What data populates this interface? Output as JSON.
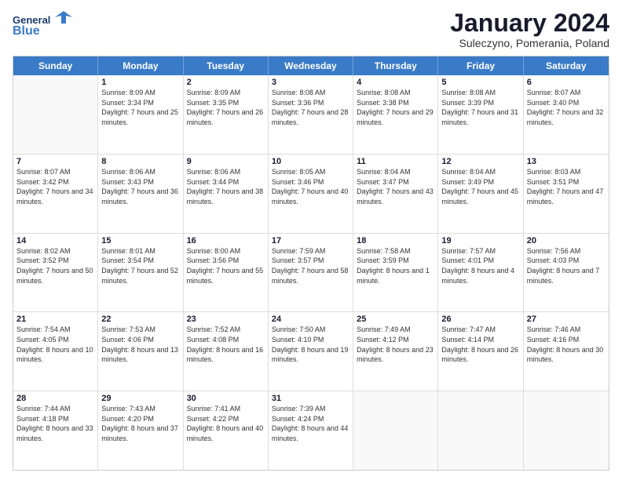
{
  "logo": {
    "line1": "General",
    "line2": "Blue"
  },
  "title": "January 2024",
  "subtitle": "Suleczyno, Pomerania, Poland",
  "header": {
    "days": [
      "Sunday",
      "Monday",
      "Tuesday",
      "Wednesday",
      "Thursday",
      "Friday",
      "Saturday"
    ]
  },
  "weeks": [
    [
      {
        "day": "",
        "sunrise": "",
        "sunset": "",
        "daylight": "",
        "empty": true
      },
      {
        "day": "1",
        "sunrise": "Sunrise: 8:09 AM",
        "sunset": "Sunset: 3:34 PM",
        "daylight": "Daylight: 7 hours and 25 minutes."
      },
      {
        "day": "2",
        "sunrise": "Sunrise: 8:09 AM",
        "sunset": "Sunset: 3:35 PM",
        "daylight": "Daylight: 7 hours and 26 minutes."
      },
      {
        "day": "3",
        "sunrise": "Sunrise: 8:08 AM",
        "sunset": "Sunset: 3:36 PM",
        "daylight": "Daylight: 7 hours and 28 minutes."
      },
      {
        "day": "4",
        "sunrise": "Sunrise: 8:08 AM",
        "sunset": "Sunset: 3:38 PM",
        "daylight": "Daylight: 7 hours and 29 minutes."
      },
      {
        "day": "5",
        "sunrise": "Sunrise: 8:08 AM",
        "sunset": "Sunset: 3:39 PM",
        "daylight": "Daylight: 7 hours and 31 minutes."
      },
      {
        "day": "6",
        "sunrise": "Sunrise: 8:07 AM",
        "sunset": "Sunset: 3:40 PM",
        "daylight": "Daylight: 7 hours and 32 minutes."
      }
    ],
    [
      {
        "day": "7",
        "sunrise": "Sunrise: 8:07 AM",
        "sunset": "Sunset: 3:42 PM",
        "daylight": "Daylight: 7 hours and 34 minutes."
      },
      {
        "day": "8",
        "sunrise": "Sunrise: 8:06 AM",
        "sunset": "Sunset: 3:43 PM",
        "daylight": "Daylight: 7 hours and 36 minutes."
      },
      {
        "day": "9",
        "sunrise": "Sunrise: 8:06 AM",
        "sunset": "Sunset: 3:44 PM",
        "daylight": "Daylight: 7 hours and 38 minutes."
      },
      {
        "day": "10",
        "sunrise": "Sunrise: 8:05 AM",
        "sunset": "Sunset: 3:46 PM",
        "daylight": "Daylight: 7 hours and 40 minutes."
      },
      {
        "day": "11",
        "sunrise": "Sunrise: 8:04 AM",
        "sunset": "Sunset: 3:47 PM",
        "daylight": "Daylight: 7 hours and 43 minutes."
      },
      {
        "day": "12",
        "sunrise": "Sunrise: 8:04 AM",
        "sunset": "Sunset: 3:49 PM",
        "daylight": "Daylight: 7 hours and 45 minutes."
      },
      {
        "day": "13",
        "sunrise": "Sunrise: 8:03 AM",
        "sunset": "Sunset: 3:51 PM",
        "daylight": "Daylight: 7 hours and 47 minutes."
      }
    ],
    [
      {
        "day": "14",
        "sunrise": "Sunrise: 8:02 AM",
        "sunset": "Sunset: 3:52 PM",
        "daylight": "Daylight: 7 hours and 50 minutes."
      },
      {
        "day": "15",
        "sunrise": "Sunrise: 8:01 AM",
        "sunset": "Sunset: 3:54 PM",
        "daylight": "Daylight: 7 hours and 52 minutes."
      },
      {
        "day": "16",
        "sunrise": "Sunrise: 8:00 AM",
        "sunset": "Sunset: 3:56 PM",
        "daylight": "Daylight: 7 hours and 55 minutes."
      },
      {
        "day": "17",
        "sunrise": "Sunrise: 7:59 AM",
        "sunset": "Sunset: 3:57 PM",
        "daylight": "Daylight: 7 hours and 58 minutes."
      },
      {
        "day": "18",
        "sunrise": "Sunrise: 7:58 AM",
        "sunset": "Sunset: 3:59 PM",
        "daylight": "Daylight: 8 hours and 1 minute."
      },
      {
        "day": "19",
        "sunrise": "Sunrise: 7:57 AM",
        "sunset": "Sunset: 4:01 PM",
        "daylight": "Daylight: 8 hours and 4 minutes."
      },
      {
        "day": "20",
        "sunrise": "Sunrise: 7:56 AM",
        "sunset": "Sunset: 4:03 PM",
        "daylight": "Daylight: 8 hours and 7 minutes."
      }
    ],
    [
      {
        "day": "21",
        "sunrise": "Sunrise: 7:54 AM",
        "sunset": "Sunset: 4:05 PM",
        "daylight": "Daylight: 8 hours and 10 minutes."
      },
      {
        "day": "22",
        "sunrise": "Sunrise: 7:53 AM",
        "sunset": "Sunset: 4:06 PM",
        "daylight": "Daylight: 8 hours and 13 minutes."
      },
      {
        "day": "23",
        "sunrise": "Sunrise: 7:52 AM",
        "sunset": "Sunset: 4:08 PM",
        "daylight": "Daylight: 8 hours and 16 minutes."
      },
      {
        "day": "24",
        "sunrise": "Sunrise: 7:50 AM",
        "sunset": "Sunset: 4:10 PM",
        "daylight": "Daylight: 8 hours and 19 minutes."
      },
      {
        "day": "25",
        "sunrise": "Sunrise: 7:49 AM",
        "sunset": "Sunset: 4:12 PM",
        "daylight": "Daylight: 8 hours and 23 minutes."
      },
      {
        "day": "26",
        "sunrise": "Sunrise: 7:47 AM",
        "sunset": "Sunset: 4:14 PM",
        "daylight": "Daylight: 8 hours and 26 minutes."
      },
      {
        "day": "27",
        "sunrise": "Sunrise: 7:46 AM",
        "sunset": "Sunset: 4:16 PM",
        "daylight": "Daylight: 8 hours and 30 minutes."
      }
    ],
    [
      {
        "day": "28",
        "sunrise": "Sunrise: 7:44 AM",
        "sunset": "Sunset: 4:18 PM",
        "daylight": "Daylight: 8 hours and 33 minutes."
      },
      {
        "day": "29",
        "sunrise": "Sunrise: 7:43 AM",
        "sunset": "Sunset: 4:20 PM",
        "daylight": "Daylight: 8 hours and 37 minutes."
      },
      {
        "day": "30",
        "sunrise": "Sunrise: 7:41 AM",
        "sunset": "Sunset: 4:22 PM",
        "daylight": "Daylight: 8 hours and 40 minutes."
      },
      {
        "day": "31",
        "sunrise": "Sunrise: 7:39 AM",
        "sunset": "Sunset: 4:24 PM",
        "daylight": "Daylight: 8 hours and 44 minutes."
      },
      {
        "day": "",
        "sunrise": "",
        "sunset": "",
        "daylight": "",
        "empty": true
      },
      {
        "day": "",
        "sunrise": "",
        "sunset": "",
        "daylight": "",
        "empty": true
      },
      {
        "day": "",
        "sunrise": "",
        "sunset": "",
        "daylight": "",
        "empty": true
      }
    ]
  ]
}
